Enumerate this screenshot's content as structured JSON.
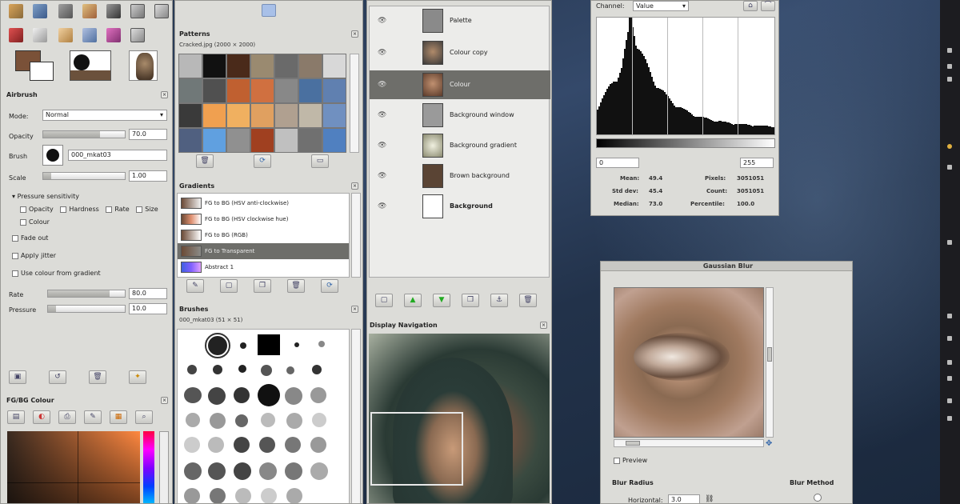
{
  "toolbox": {
    "tool_options_title": "Airbrush",
    "mode_label": "Mode:",
    "mode_value": "Normal",
    "opacity_label": "Opacity",
    "opacity_value": "70.0",
    "opacity_fraction": 0.7,
    "brush_label": "Brush",
    "brush_name": "000_mkat03",
    "scale_label": "Scale",
    "scale_value": "1.00",
    "scale_fraction": 0.1,
    "pressure_sensitivity": "Pressure sensitivity",
    "opacity_check": "Opacity",
    "hardness_check": "Hardness",
    "rate_check": "Rate",
    "size_check": "Size",
    "colour_check": "Colour",
    "fade_out": "Fade out",
    "apply_jitter": "Apply jitter",
    "use_colour_gradient": "Use colour from gradient",
    "rate_label": "Rate",
    "rate_value": "80.0",
    "rate_fraction": 0.8,
    "pressure_label": "Pressure",
    "pressure_value": "10.0",
    "pressure_fraction": 0.1,
    "colour_dock_title": "FG/BG Colour"
  },
  "patterns": {
    "title": "Patterns",
    "subtitle": "Cracked.jpg (2000 × 2000)"
  },
  "gradients": {
    "title": "Gradients",
    "items": [
      {
        "label": "FG to BG (HSV anti-clockwise)"
      },
      {
        "label": "FG to BG (HSV clockwise hue)"
      },
      {
        "label": "FG to BG (RGB)"
      },
      {
        "label": "FG to Transparent"
      },
      {
        "label": "Abstract 1"
      }
    ]
  },
  "brushes": {
    "title": "Brushes",
    "subtitle": "000_mkat03 (51 × 51)"
  },
  "layers": {
    "items": [
      {
        "label": "Palette"
      },
      {
        "label": "Colour copy"
      },
      {
        "label": "Colour"
      },
      {
        "label": "Background window"
      },
      {
        "label": "Background gradient"
      },
      {
        "label": "Brown background"
      },
      {
        "label": "Background"
      }
    ]
  },
  "navigation": {
    "title": "Display Navigation"
  },
  "histogram": {
    "channel_label": "Channel:",
    "channel_value": "Value",
    "range_low": "0",
    "range_high": "255",
    "mean_label": "Mean:",
    "mean_value": "49.4",
    "std_label": "Std dev:",
    "std_value": "45.4",
    "median_label": "Median:",
    "median_value": "73.0",
    "pixels_label": "Pixels:",
    "pixels_value": "3051051",
    "count_label": "Count:",
    "count_value": "3051051",
    "percentile_label": "Percentile:",
    "percentile_value": "100.0"
  },
  "gaussian": {
    "title": "Gaussian Blur",
    "preview_label": "Preview",
    "blur_radius_label": "Blur Radius",
    "blur_method_label": "Blur Method",
    "horizontal_label": "Horizontal:",
    "horizontal_value": "3.0"
  },
  "colors": {
    "panel_bg": "#dcdcd8",
    "selection": "#6e6e6a",
    "desktop": "#2a3b55"
  }
}
